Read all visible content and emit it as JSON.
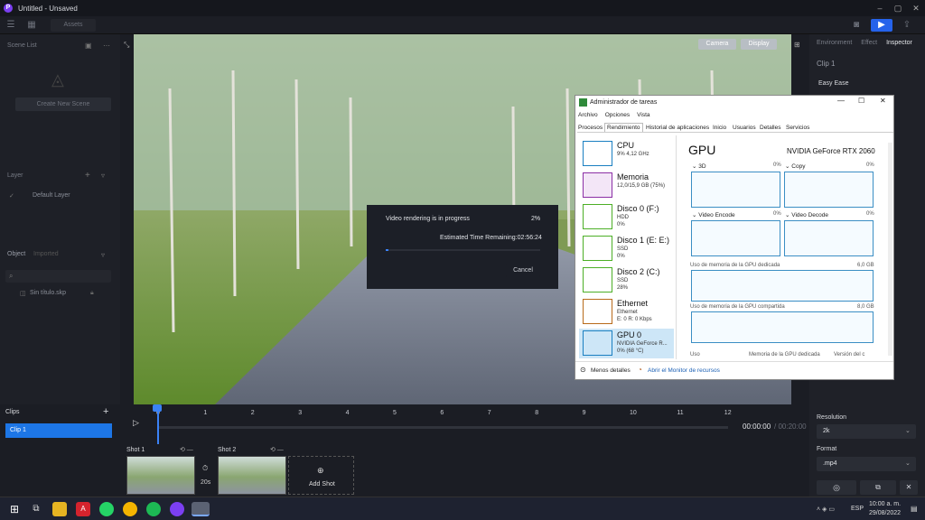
{
  "app": {
    "title": "Untitled - Unsaved",
    "logo_letter": "P"
  },
  "toolbar": {
    "assets_label": "Assets"
  },
  "left": {
    "scene_list": "Scene List",
    "create_scene": "Create New Scene",
    "layer": "Layer",
    "default_layer": "Default Layer",
    "object": "Object",
    "imported": "Imported",
    "file": "Sin título.skp"
  },
  "viewport": {
    "camera": "Camera",
    "display": "Display"
  },
  "dialog": {
    "status": "Video rendering is in progress",
    "percent": "2%",
    "remaining": "Estimated Time Remaining:02:56:24",
    "progress": 0.02,
    "cancel": "Cancel"
  },
  "right": {
    "tabs": [
      "Environment",
      "Effect",
      "Inspector"
    ],
    "clip_title": "Clip 1",
    "easy_ease": "Easy Ease",
    "resolution_label": "Resolution",
    "resolution_value": "2k",
    "format_label": "Format",
    "format_value": ".mp4"
  },
  "clips": {
    "title": "Clips",
    "add": "+",
    "item": "Clip 1"
  },
  "timeline": {
    "ticks": [
      "0",
      "1",
      "2",
      "3",
      "4",
      "5",
      "6",
      "7",
      "8",
      "9",
      "10",
      "11",
      "12"
    ],
    "current": "00:00:00",
    "total": "00:20:00",
    "shot1": "Shot 1",
    "shot2": "Shot 2",
    "duration": "20s",
    "add_shot": "Add Shot"
  },
  "taskmgr": {
    "title": "Administrador de tareas",
    "menu": [
      "Archivo",
      "Opciones",
      "Vista"
    ],
    "tabs": [
      "Procesos",
      "Rendimiento",
      "Historial de aplicaciones",
      "Inicio",
      "Usuarios",
      "Detalles",
      "Servicios"
    ],
    "resources": [
      {
        "name": "CPU",
        "detail": "9% 4,12 GHz",
        "color": "#1a7fc1"
      },
      {
        "name": "Memoria",
        "detail": "12,0/15,9 GB (75%)",
        "color": "#8b2fa5"
      },
      {
        "name": "Disco 0 (F:)",
        "detail": "HDD\n0%",
        "color": "#4caf26"
      },
      {
        "name": "Disco 1 (E: E:)",
        "detail": "SSD\n0%",
        "color": "#4caf26"
      },
      {
        "name": "Disco 2 (C:)",
        "detail": "SSD\n28%",
        "color": "#4caf26"
      },
      {
        "name": "Ethernet",
        "detail": "Ethernet\nE: 0 R: 0 Kbps",
        "color": "#b86a1a"
      },
      {
        "name": "GPU 0",
        "detail": "NVIDIA GeForce R...\n0% (68 °C)",
        "color": "#1a7fc1"
      }
    ],
    "gpu_title": "GPU",
    "gpu_model": "NVIDIA GeForce RTX 2060",
    "engines": [
      {
        "name": "3D",
        "pct": "0%"
      },
      {
        "name": "Copy",
        "pct": "0%"
      },
      {
        "name": "Video Encode",
        "pct": "0%"
      },
      {
        "name": "Video Decode",
        "pct": "0%"
      }
    ],
    "dedicated_label": "Uso de memoria de la GPU dedicada",
    "dedicated_max": "6,0 GB",
    "shared_label": "Uso de memoria de la GPU compartida",
    "shared_max": "8,0 GB",
    "footer_cols": [
      "Uso",
      "Memoria de la GPU dedicada",
      "Versión del c"
    ],
    "less_details": "Menos detalles",
    "open_monitor": "Abrir el Monitor de recursos"
  },
  "taskbar": {
    "lang": "ESP",
    "time": "10:00 a. m.",
    "date": "29/08/2022"
  }
}
